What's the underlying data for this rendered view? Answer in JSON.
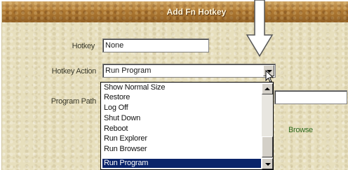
{
  "dialog": {
    "title": "Add Fn Hotkey"
  },
  "hotkey": {
    "label": "Hotkey",
    "value": "None"
  },
  "hotkey_action": {
    "label": "Hotkey Action",
    "selected": "Run Program",
    "options": [
      "Show Normal Size",
      "Restore",
      "Log Off",
      "Shut Down",
      "Reboot",
      "Run Explorer",
      "Run Browser",
      "Run Program"
    ],
    "highlighted_option": "Run Program"
  },
  "program_path": {
    "label": "Program Path",
    "value": ""
  },
  "browse": {
    "label": "Browse"
  },
  "icons": {
    "dropdown": "chevron-down-icon",
    "scroll_up": "scroll-up-icon",
    "scroll_down": "scroll-down-icon",
    "pointer": "down-arrow-icon",
    "cursor": "mouse-pointer-icon"
  },
  "colors": {
    "title_bar": "#b07a33",
    "dialog_bg": "#e7dfbd",
    "selection": "#0a246a",
    "browse_text": "#2f6a1c"
  }
}
